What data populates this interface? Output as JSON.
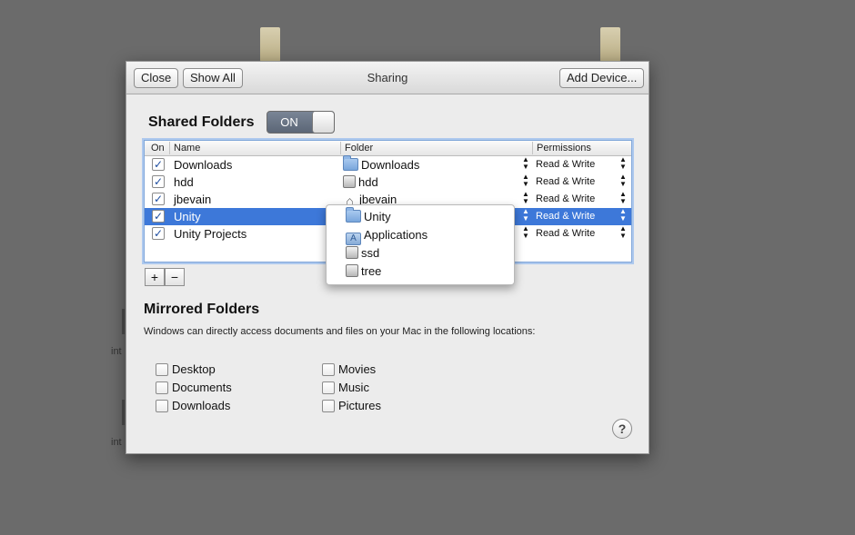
{
  "window": {
    "title": "Sharing",
    "close_label": "Close",
    "show_all_label": "Show All",
    "add_device_label": "Add Device..."
  },
  "background": {
    "label_1": "int",
    "label_2": "int"
  },
  "shared_folders": {
    "title": "Shared Folders",
    "toggle_label": "ON",
    "toggle_state": "on",
    "columns": {
      "on": "On",
      "name": "Name",
      "folder": "Folder",
      "permissions": "Permissions"
    },
    "rows": [
      {
        "checked": true,
        "name": "Downloads",
        "folder": "Downloads",
        "folder_icon": "folder-icon",
        "permission": "Read & Write",
        "selected": false
      },
      {
        "checked": true,
        "name": "hdd",
        "folder": "hdd",
        "folder_icon": "drive-icon",
        "permission": "Read & Write",
        "selected": false
      },
      {
        "checked": true,
        "name": "jbevain",
        "folder": "jbevain",
        "folder_icon": "home-icon",
        "permission": "Read & Write",
        "selected": false
      },
      {
        "checked": true,
        "name": "Unity",
        "folder": "",
        "folder_icon": "",
        "permission": "Read & Write",
        "selected": true
      },
      {
        "checked": true,
        "name": "Unity Projects",
        "folder": "",
        "folder_icon": "",
        "permission": "Read & Write",
        "selected": false
      }
    ],
    "folder_popup": [
      {
        "label": "Unity",
        "icon": "folder-icon"
      },
      {
        "label": "Applications",
        "icon": "applications-folder-icon"
      },
      {
        "label": "ssd",
        "icon": "drive-icon"
      },
      {
        "label": "tree",
        "icon": "drive-icon"
      }
    ],
    "add_label": "+",
    "remove_label": "−"
  },
  "mirrored_folders": {
    "title": "Mirrored Folders",
    "description": "Windows can directly access documents and files on your Mac in the following locations:",
    "items": [
      {
        "label": "Desktop",
        "checked": false
      },
      {
        "label": "Documents",
        "checked": false
      },
      {
        "label": "Downloads",
        "checked": false
      },
      {
        "label": "Movies",
        "checked": false
      },
      {
        "label": "Music",
        "checked": false
      },
      {
        "label": "Pictures",
        "checked": false
      }
    ]
  },
  "help_label": "?",
  "colors": {
    "selection": "#3d78d9",
    "backdrop": "#6b6b6b",
    "dialog": "#ececec"
  }
}
